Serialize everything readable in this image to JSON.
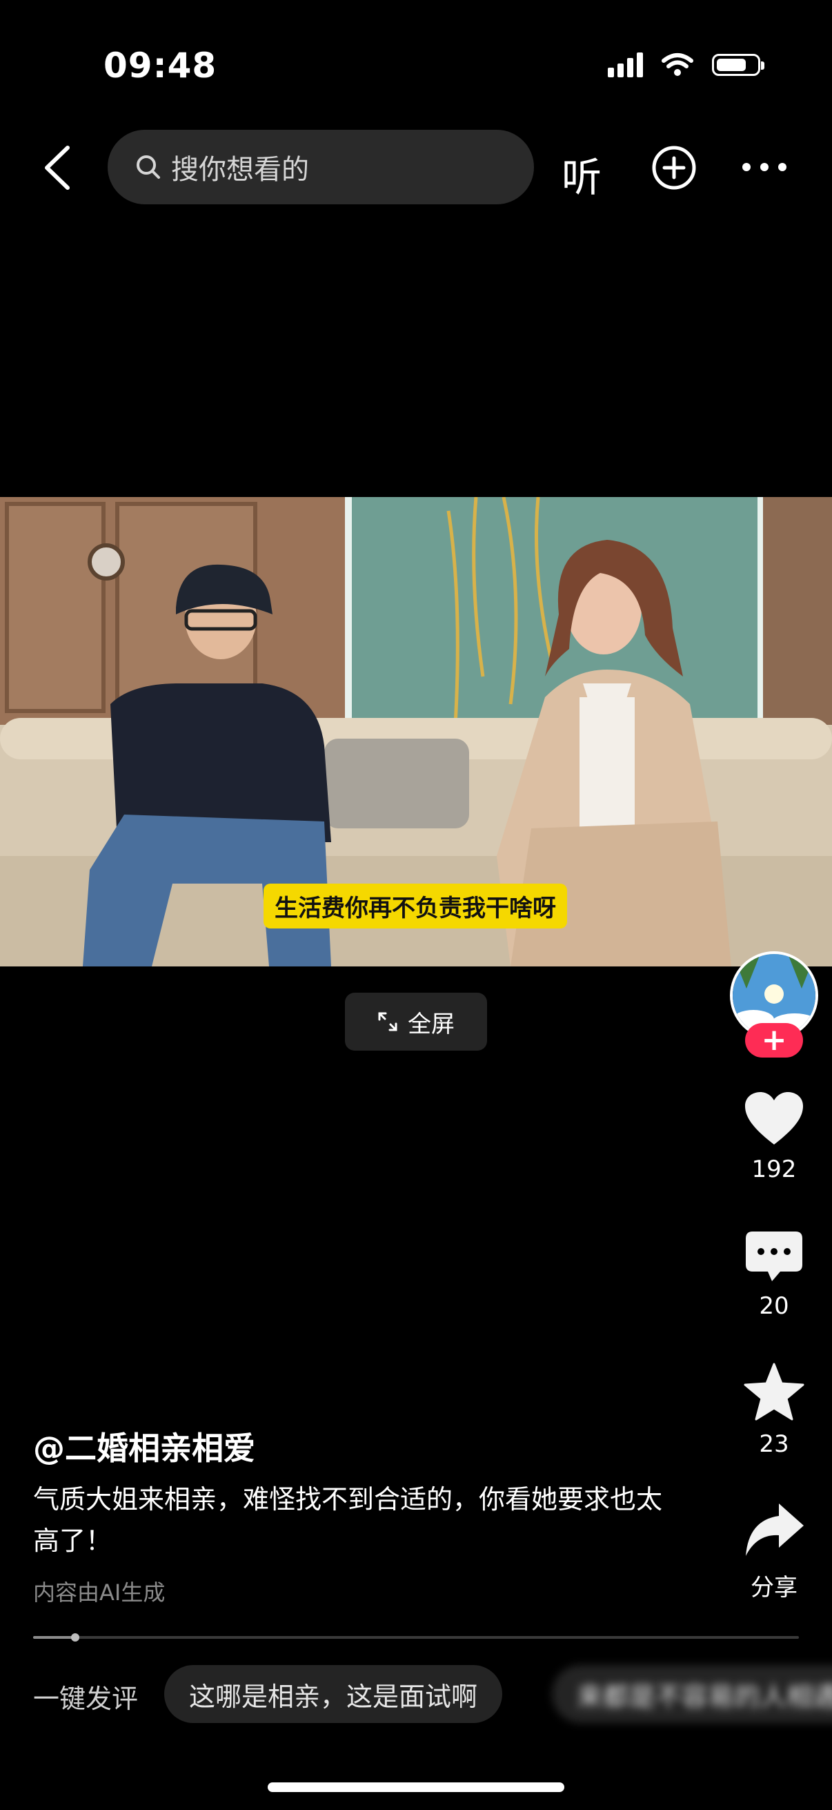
{
  "status_bar": {
    "time": "09:48"
  },
  "nav": {
    "search_placeholder": "搜你想看的",
    "listen_label": "听"
  },
  "video": {
    "subtitle": "生活费你再不负责我干啥呀",
    "fullscreen_label": "全屏"
  },
  "actions": {
    "likes": "192",
    "comments": "20",
    "favorites": "23",
    "share_label": "分享"
  },
  "post": {
    "author": "@二婚相亲相爱",
    "description": "气质大姐来相亲，难怪找不到合适的，你看她要求也太高了！",
    "ai_note": "内容由AI生成",
    "progress": 0.055
  },
  "quick_comment": {
    "label": "一键发评",
    "chips": [
      "这哪是相亲，这是面试啊",
      "来都是不容易的人相遇"
    ]
  },
  "colors": {
    "follow": "#fe2c55",
    "subtitle_bg": "#f5d800",
    "chip_bg": "#242424"
  }
}
